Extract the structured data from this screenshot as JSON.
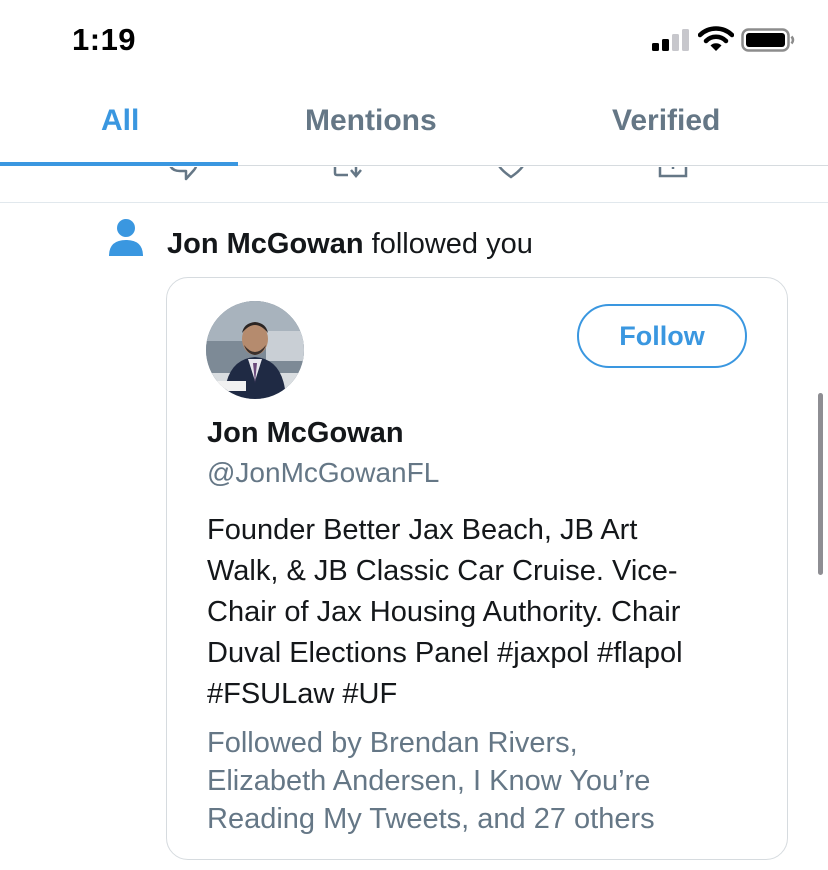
{
  "status_bar": {
    "time": "1:19",
    "icons": [
      "cellular-signal-icon",
      "wifi-icon",
      "battery-icon"
    ]
  },
  "tabs": [
    {
      "label": "All",
      "active": true
    },
    {
      "label": "Mentions",
      "active": false
    },
    {
      "label": "Verified",
      "active": false
    }
  ],
  "tweet_actions": [
    "reply-icon",
    "retweet-icon",
    "like-icon",
    "share-icon"
  ],
  "notification": {
    "icon": "person-icon",
    "actor_name": "Jon McGowan",
    "action_text": " followed you"
  },
  "user_card": {
    "name": "Jon McGowan",
    "handle": "@JonMcGowanFL",
    "follow_label": "Follow",
    "bio_lines": [
      "Founder Better Jax Beach, JB Art",
      "Walk, & JB Classic Car Cruise. Vice-",
      "Chair of Jax Housing Authority. Chair",
      "Duval Elections Panel #jaxpol #flapol",
      "#FSULaw #UF"
    ],
    "followed_by_lines": [
      "Followed by Brendan Rivers,",
      "Elizabeth Andersen, I Know You’re",
      "Reading My Tweets, and 27 others"
    ]
  },
  "colors": {
    "accent": "#3a97e0",
    "secondary_text": "#657786",
    "primary_text": "#14171a",
    "border": "#d6dbdf"
  }
}
